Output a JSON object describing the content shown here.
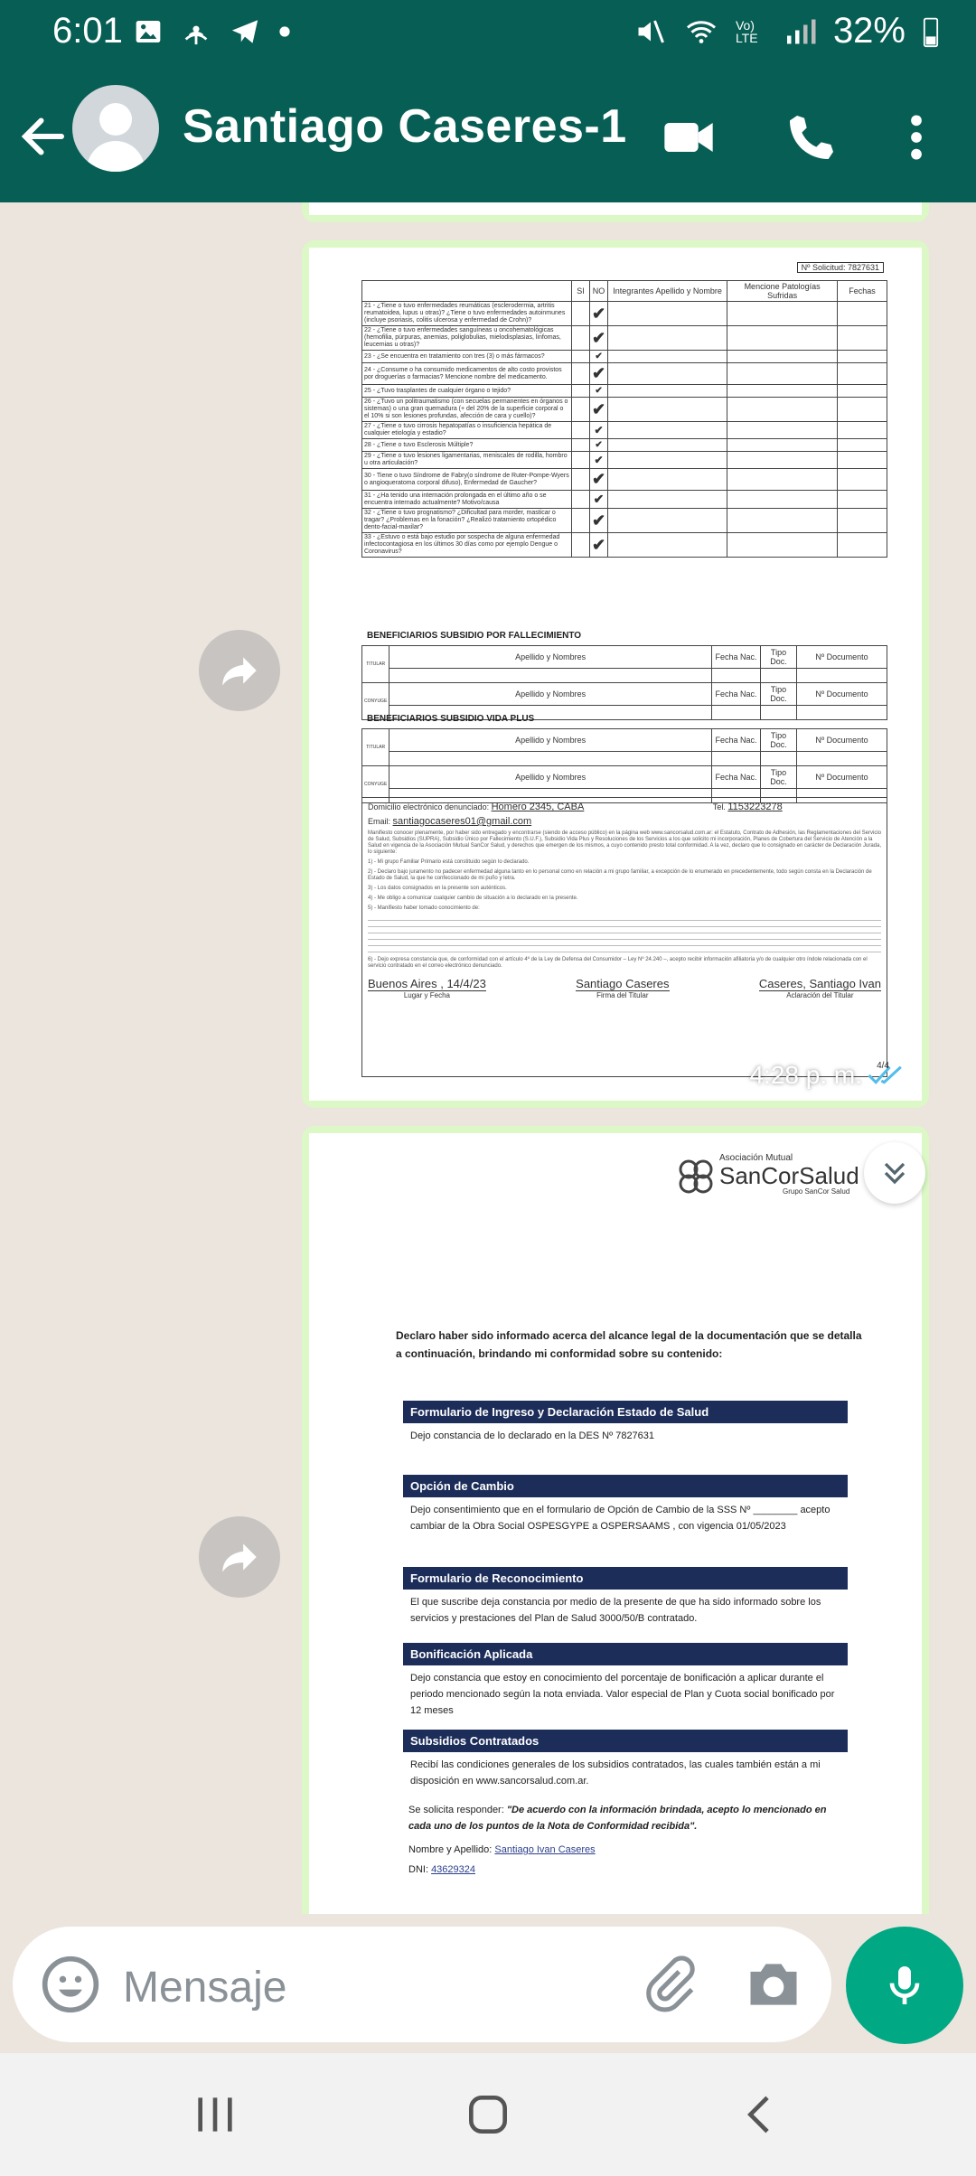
{
  "status": {
    "time": "6:01",
    "volte": "Vo) LTE",
    "battery": "32%"
  },
  "header": {
    "title": "Santiago Caseres-1..."
  },
  "doc1": {
    "nro_solicitud": "Nº Solicitud: 7827631",
    "cols": [
      "SI",
      "NO",
      "Integrantes Apellido y Nombre",
      "Mencione Patologías Sufridas",
      "Fechas"
    ],
    "questions": [
      "21 - ¿Tiene o tuvo enfermedades reumáticas (esclerodermia, artritis reumatoidea, lupus u otras)? ¿Tiene o tuvo enfermedades autoinmunes (incluye psoriasis, colitis ulcerosa y enfermedad de Crohn)?",
      "22 - ¿Tiene o tuvo enfermedades sanguíneas u oncohematológicas (hemofilia, púrpuras, anemias, poliglobulias, mielodisplasias, linfomas, leucemias u otras)?",
      "23 - ¿Se encuentra en tratamiento con tres (3) o más fármacos?",
      "24 - ¿Consume o ha consumido medicamentos de alto costo provistos por droguerías o farmacias? Mencione nombre del medicamento.",
      "25 - ¿Tuvo trasplantes de cualquier órgano o tejido?",
      "26 - ¿Tuvo un politraumatismo (con secuelas permanentes en órganos o sistemas) o una gran quemadura (+ del 20% de la superficie corporal o el 10% si son lesiones profundas, afección de cara y cuello)?",
      "27 - ¿Tiene o tuvo cirrosis hepatopatías o insuficiencia hepática de cualquier etiología y estadio?",
      "28 - ¿Tiene o tuvo Esclerosis Múltiple?",
      "29 - ¿Tiene o tuvo lesiones ligamentarias, meniscales de rodilla, hombro u otra articulación?",
      "30 - Tiene o tuvo Síndrome de Fabry(o síndrome de Ruter-Pompe-Wyers o angioqueratoma corporal difuso), Enfermedad de Gaucher?",
      "31 - ¿Ha tenido una internación prolongada en el último año o se encuentra internado actualmente? Motivo/causa",
      "32 - ¿Tiene o tuvo prognatismo? ¿Dificultad para morder, masticar o tragar? ¿Problemas en la fonación? ¿Realizó tratamiento ortopédico dento-facial-maxilar?",
      "33 - ¿Estuvo o está bajo estudio por sospecha de alguna enfermedad infectocontagiosa en los últimos 30 días como por ejemplo Dengue o Coronavirus?"
    ],
    "check": "✔",
    "sec_fallecimiento": "BENEFICIARIOS SUBSIDIO POR FALLECIMIENTO",
    "sec_vida": "BENEFICIARIOS SUBSIDIO VIDA PLUS",
    "ben_cols": [
      "Apellido y Nombres",
      "Fecha Nac.",
      "Tipo Doc.",
      "Nº Documento"
    ],
    "side_titular": "TITULAR",
    "side_conyuge": "CONYUGE",
    "domicilio_label": "Domicilio electrónico denunciado:",
    "domicilio": "Homero 2345, CABA",
    "tel_label": "Tel.",
    "tel": "1153223278",
    "email_label": "Email:",
    "email": "santiagocaseres01@gmail.com",
    "fine1": "Manifiesto conocer plenamente, por haber sido entregado y encontrarse (siendo de acceso público) en la página web www.sancorsalud.com.ar: el Estatuto, Contrato de Adhesión, las Reglamentaciones del Servicio de Salud, Subsidios (SUPRA), Subsidio Único por Fallecimiento (S.U.F.), Subsidio Vida Plus y Resoluciones de los Servicios a los que solicito mi incorporación, Planes de Cobertura del Servicio de Atención a la Salud en vigencia de la Asociación Mutual SanCor Salud, y derechos que emergen de los mismos, a cuyo contenido presto total conformidad. A la vez, declaro que lo consignado en carácter de Declaración Jurada, lo siguiente:",
    "fine_items": [
      "1) - Mi grupo Familiar Primario está constituido según lo declarado.",
      "2) - Declaro bajo juramento no padecer enfermedad alguna tanto en lo personal como en relación a mi grupo familiar, a excepción de lo enumerado en precedentemente, todo según consta en la Declaración de Estado de Salud, la que he confeccionado de mi puño y letra.",
      "3) - Los datos consignados en la presente son auténticos.",
      "4) - Me obligo a comunicar cualquier cambio de situación a lo declarado en la presente.",
      "5) - Manifiesto haber tomado conocimiento de:",
      "6) - Dejo expresa constancia que, de conformidad con el artículo 4º de la Ley de Defensa del Consumidor – Ley Nº 24.240 –, acepto recibir información afiliatoria y/o de cualquier otro índole relacionada con el servicio contratado en el correo electrónico denunciado."
    ],
    "lugar": "Buenos Aires , 14/4/23",
    "lugar_label": "Lugar y Fecha",
    "firma": "Santiago Caseres",
    "firma_label": "Firma del Titular",
    "aclaracion": "Caseres, Santiago Ivan",
    "aclaracion_label": "Aclaración del Titular",
    "page": "4/4",
    "time": "4:28 p. m."
  },
  "doc2": {
    "logo_top": "Asociación Mutual",
    "logo_name": "SanCorSalud",
    "logo_sub": "Grupo SanCor Salud",
    "intro": "Declaro haber sido informado acerca del alcance legal de la documentación que se detalla a continuación, brindando mi conformidad sobre su contenido:",
    "blocks": [
      {
        "h": "Formulario de Ingreso y Declaración Estado de Salud",
        "t": "Dejo constancia de lo declarado en la DES Nº 7827631"
      },
      {
        "h": "Opción de Cambio",
        "t": "Dejo consentimiento que en el formulario de Opción de Cambio de la SSS Nº ________ acepto cambiar de la Obra Social OSPESGYPE a OSPERSAAMS , con vigencia 01/05/2023"
      },
      {
        "h": "Formulario de Reconocimiento",
        "t": "El que suscribe deja constancia por medio de la presente de que ha sido informado sobre los servicios y prestaciones del Plan de Salud 3000/50/B contratado."
      },
      {
        "h": "Bonificación Aplicada",
        "t": "Dejo constancia que estoy en conocimiento del porcentaje de bonificación a aplicar durante el periodo mencionado según la nota enviada. Valor especial de Plan y Cuota social bonificado por 12 meses"
      },
      {
        "h": "Subsidios Contratados",
        "t": "Recibí las condiciones generales de los subsidios contratados, las cuales también están a mi disposición en www.sancorsalud.com.ar."
      }
    ],
    "resp_label": "Se solicita responder:",
    "resp_text": "\"De acuerdo con la información brindada, acepto lo mencionado en cada uno de los puntos de la Nota de Conformidad recibida\".",
    "nombre_label": "Nombre y Apellido:",
    "nombre": "Santiago Ivan Caseres",
    "dni_label": "DNI:",
    "dni": "43629324"
  },
  "input": {
    "placeholder": "Mensaje"
  },
  "colors": {
    "header": "#075e54",
    "accent": "#00a884",
    "bubble": "#dcf8c6",
    "doc_header": "#1c2d5a"
  }
}
